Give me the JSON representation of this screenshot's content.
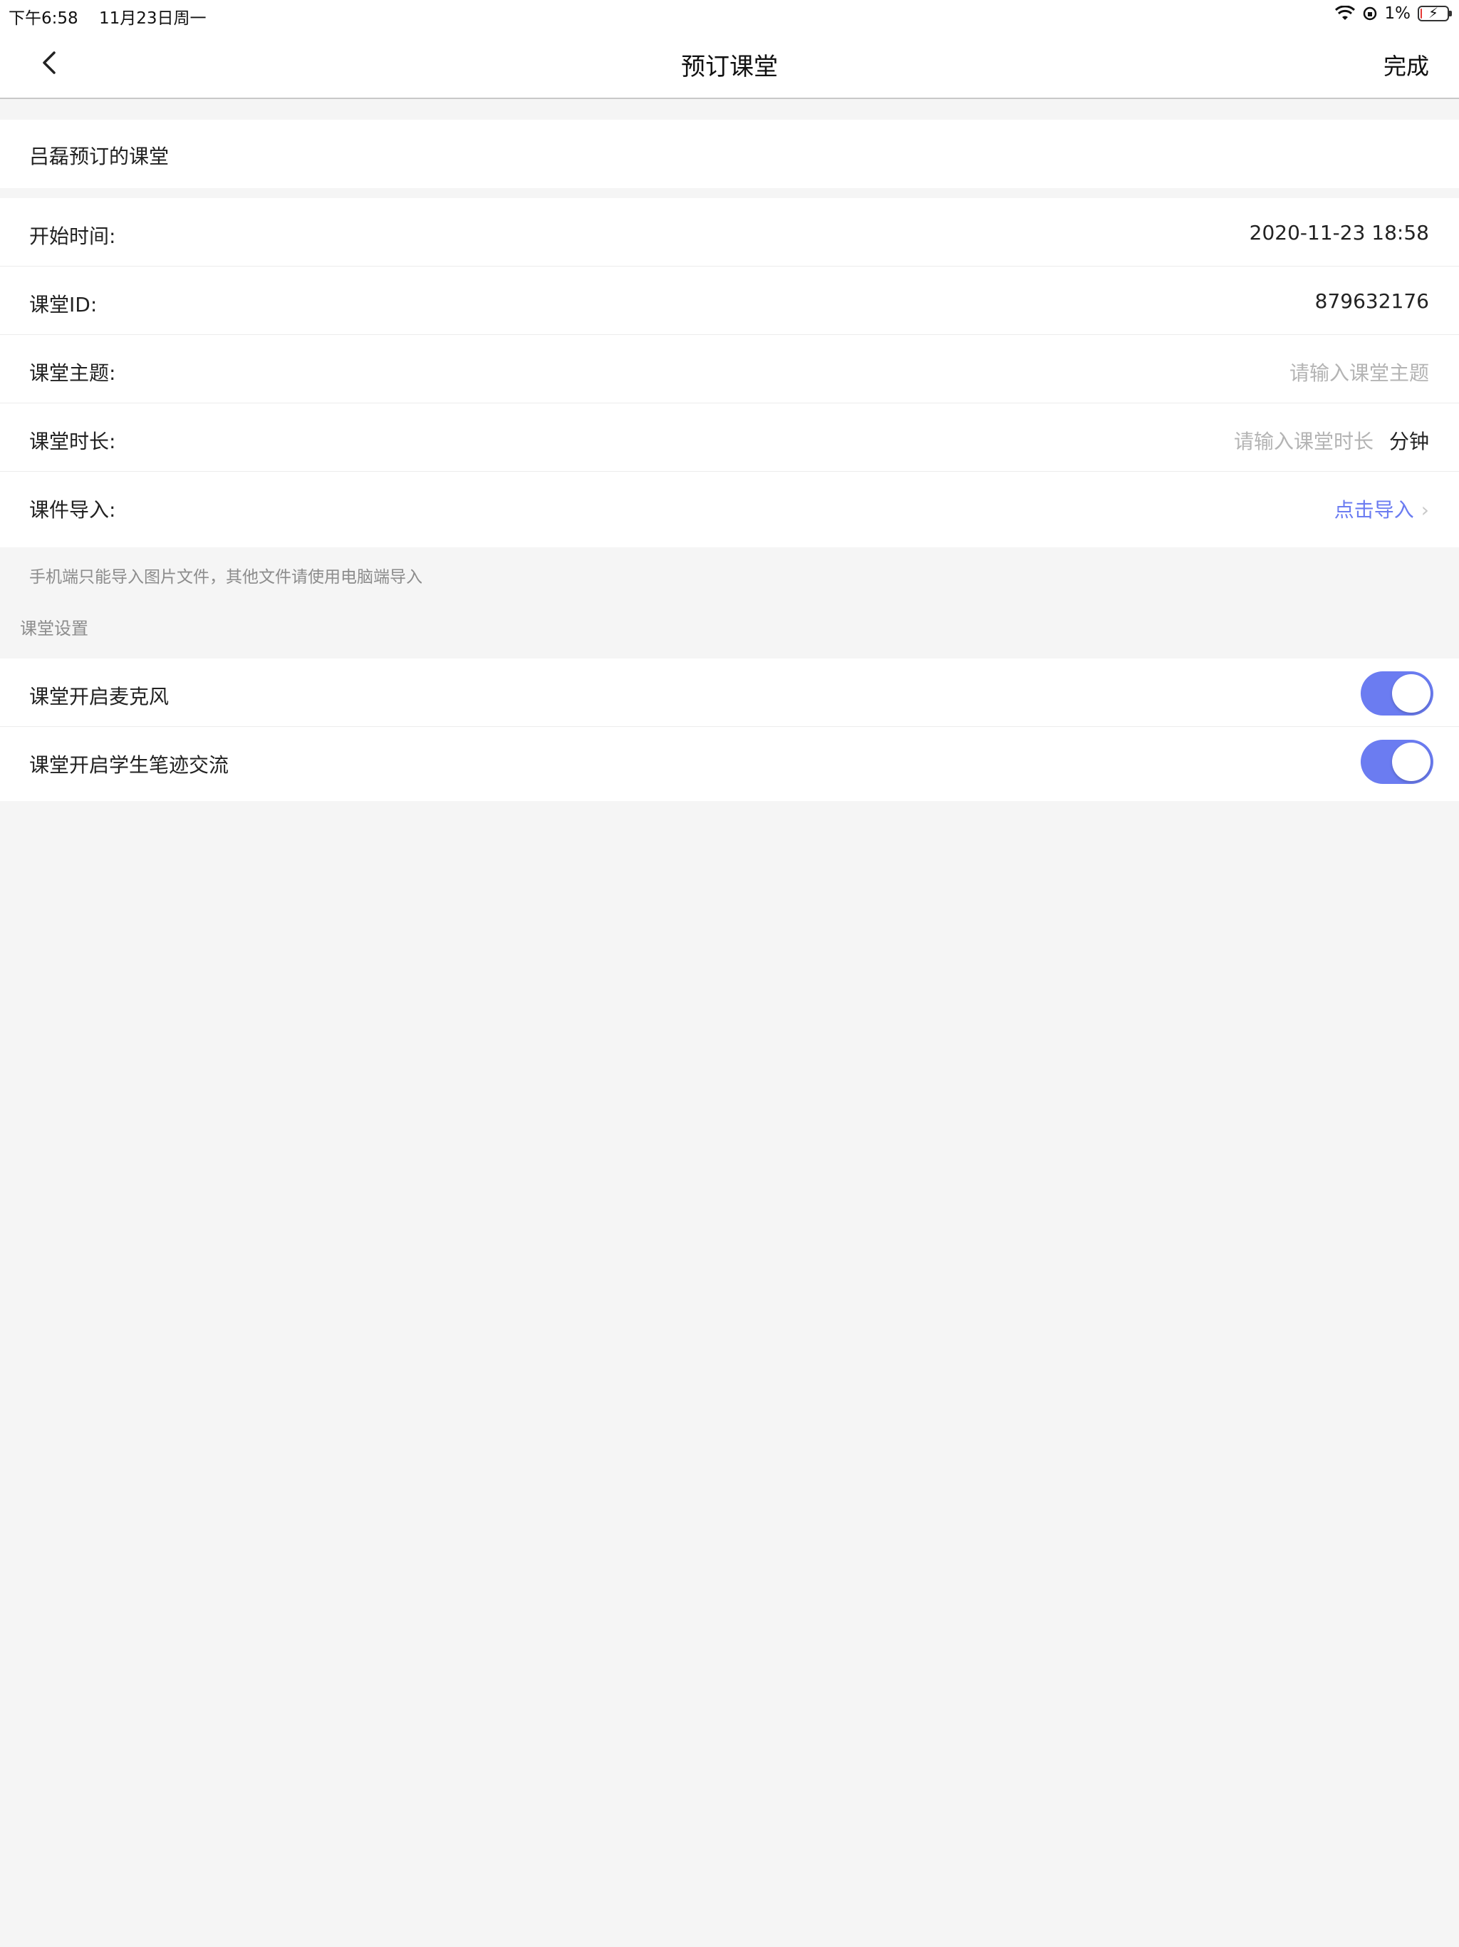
{
  "status_bar": {
    "time": "下午6:58",
    "date": "11月23日周一",
    "battery_percent_label": "1%",
    "battery_level": 0.01
  },
  "nav": {
    "title": "预订课堂",
    "done_label": "完成",
    "back_icon": "chevron-left-icon"
  },
  "owner": {
    "text": "吕磊预订的课堂"
  },
  "info_rows": {
    "start_time": {
      "label": "开始时间:",
      "value": "2020-11-23 18:58"
    },
    "class_id": {
      "label": "课堂ID:",
      "value": "879632176"
    },
    "topic": {
      "label": "课堂主题:",
      "placeholder": "请输入课堂主题"
    },
    "duration": {
      "label": "课堂时长:",
      "placeholder": "请输入课堂时长",
      "unit": "分钟"
    },
    "courseware": {
      "label": "课件导入:",
      "action": "点击导入"
    }
  },
  "hint": "手机端只能导入图片文件，其他文件请使用电脑端导入",
  "settings": {
    "header": "课堂设置",
    "items": [
      {
        "label": "课堂开启麦克风",
        "enabled": true
      },
      {
        "label": "课堂开启学生笔迹交流",
        "enabled": true
      }
    ]
  },
  "colors": {
    "accent": "#6b7cf1",
    "background": "#f5f5f5",
    "placeholder": "#b4b4b4"
  }
}
